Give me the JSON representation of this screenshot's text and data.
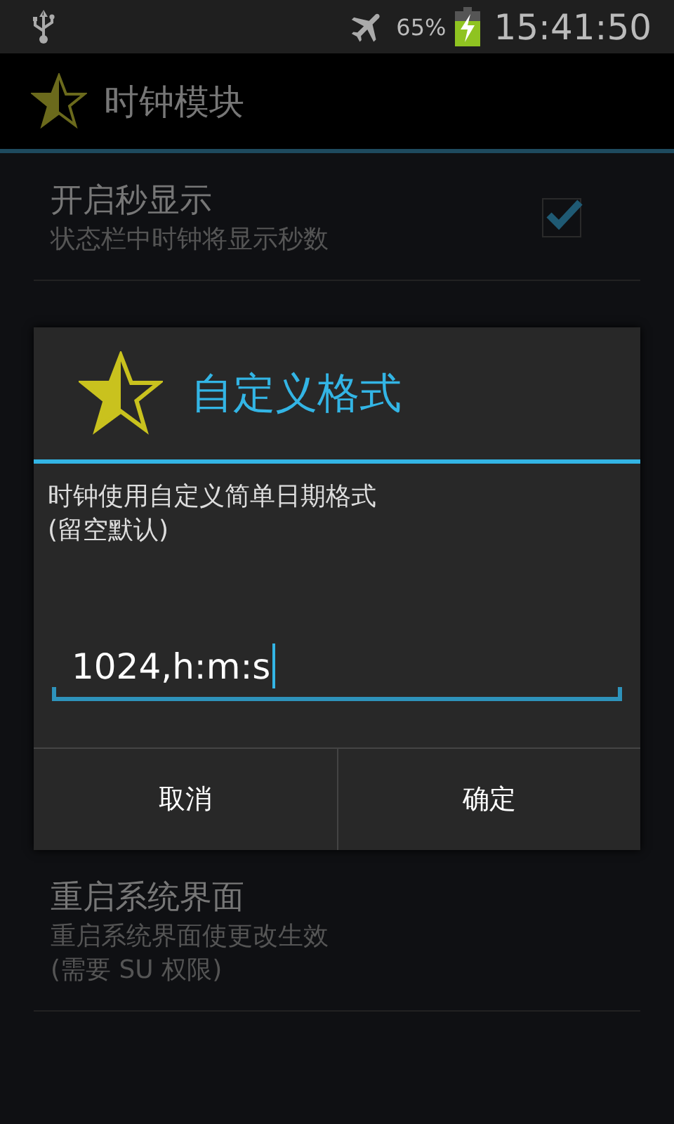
{
  "status_bar": {
    "battery": "65%",
    "time": "15:41:50"
  },
  "action_bar": {
    "title": "时钟模块"
  },
  "preferences": [
    {
      "kind": "checkbox",
      "title": "开启秒显示",
      "summary": "状态栏中时钟将显示秒数",
      "checked": true
    },
    {
      "kind": "action",
      "title": "重启系统界面",
      "summary": "重启系统界面使更改生效\n(需要 SU 权限)"
    }
  ],
  "dialog": {
    "title": "自定义格式",
    "message": "时钟使用自定义简单日期格式\n(留空默认)",
    "value": "1024,h:m:s",
    "buttons": [
      {
        "label": "取消"
      },
      {
        "label": "确定"
      }
    ]
  }
}
